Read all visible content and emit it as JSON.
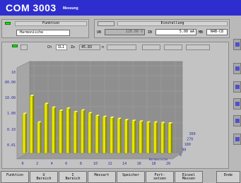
{
  "title": {
    "main": "COM 3003",
    "sub": "Messung"
  },
  "funktion": {
    "header": "Funktion",
    "value": "Harmonische"
  },
  "einstellung": {
    "header": "Einstellung",
    "ub_label": "UB",
    "ub_value": "120.00 V",
    "ib_label": "IB",
    "ib_value": "5.00 mA",
    "mb_label": "MB",
    "mb_value": "N4B-C8"
  },
  "chart_controls": {
    "ch_label": "Ch",
    "ch_value": "IL1",
    "zo_label": "Zo",
    "zo_value": "45.83",
    "n_label": "n"
  },
  "chart_data": {
    "type": "bar",
    "scale": "log",
    "y_ticks": [
      "10",
      "100.00",
      "10.00",
      "1.00",
      "0.10",
      "0.01"
    ],
    "x_ticks": [
      "0",
      "2",
      "4",
      "6",
      "8",
      "10",
      "12",
      "14",
      "16",
      "18",
      "20"
    ],
    "x_label": "Harmonische",
    "z_ticks": [
      "0",
      "90",
      "180",
      "270",
      "360"
    ],
    "categories": [
      "1",
      "2",
      "3",
      "4",
      "5",
      "6",
      "7",
      "8",
      "9",
      "10",
      "11",
      "12",
      "13",
      "14",
      "15",
      "16",
      "17",
      "18",
      "19",
      "20",
      "21"
    ],
    "values": [
      1.3,
      12,
      0.45,
      4.5,
      2.8,
      1.9,
      2.5,
      1.6,
      2.0,
      1.4,
      1.0,
      0.9,
      0.8,
      0.7,
      0.6,
      0.55,
      0.5,
      0.45,
      0.45,
      0.42,
      0.4
    ],
    "bar_color": "#e6e600"
  },
  "softkeys": [
    {
      "line1": "Funktion",
      "line2": ""
    },
    {
      "line1": "U",
      "line2": "Bereich"
    },
    {
      "line1": "I",
      "line2": "Bereich"
    },
    {
      "line1": "Messart",
      "line2": ""
    },
    {
      "line1": "Speicher",
      "line2": ""
    },
    {
      "line1": "Fort-",
      "line2": "setzen"
    },
    {
      "line1": "Einzel",
      "line2": "Messen"
    },
    {
      "line1": "Ende",
      "line2": ""
    }
  ]
}
